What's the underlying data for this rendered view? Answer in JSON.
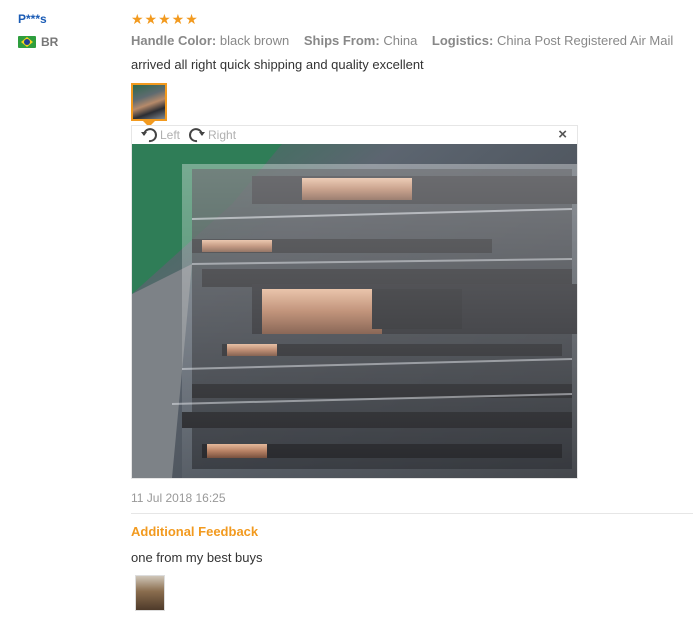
{
  "user": {
    "name": "P***s",
    "country_code": "BR"
  },
  "review": {
    "stars": "★★★★★",
    "attributes": [
      {
        "label": "Handle Color:",
        "value": "black brown"
      },
      {
        "label": "Ships From:",
        "value": "China"
      },
      {
        "label": "Logistics:",
        "value": "China Post Registered Air Mail"
      }
    ],
    "text": "arrived all right quick shipping and quality excellent",
    "date": "11 Jul 2018 16:25"
  },
  "viewer": {
    "rotate_left_label": "Left",
    "rotate_right_label": "Right",
    "close_label": "×"
  },
  "additional": {
    "title": "Additional Feedback",
    "text": "one from my best buys"
  },
  "colors": {
    "accent": "#f29a1f",
    "username": "#1a5bb5"
  }
}
